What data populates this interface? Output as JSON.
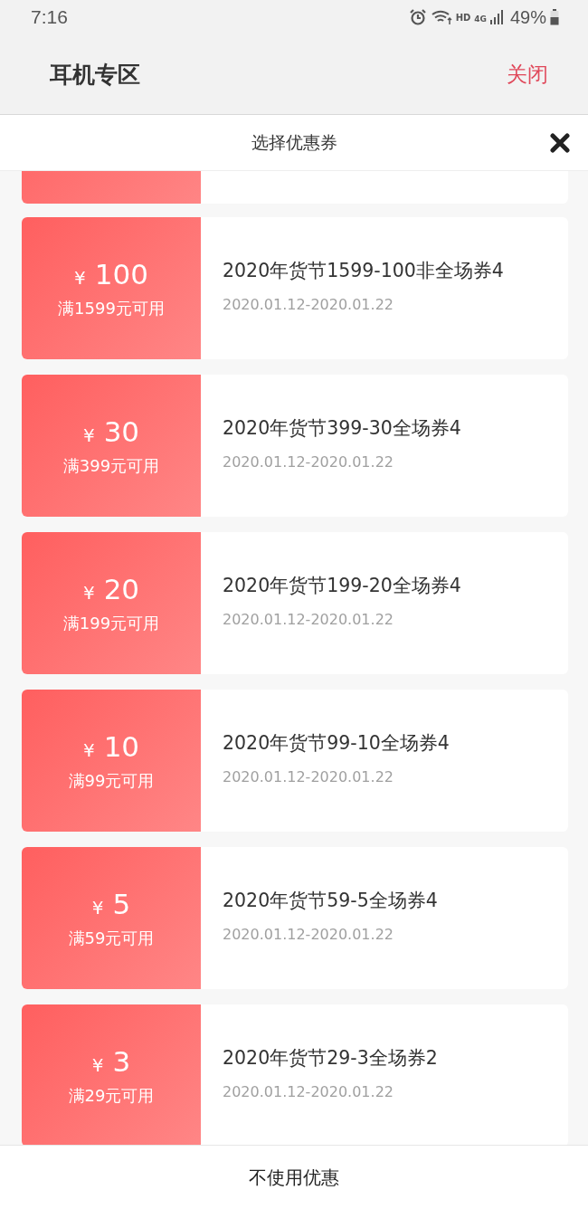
{
  "status_bar": {
    "time": "7:16",
    "hd": "HD",
    "network": "4G",
    "battery": "49%"
  },
  "header": {
    "title": "耳机专区",
    "close": "关闭"
  },
  "sheet": {
    "title": "选择优惠券",
    "coupons": [
      {
        "currency": "¥",
        "amount": "100",
        "condition": "满1599元可用",
        "name": "2020年货节1599-100非全场券4",
        "dates": "2020.01.12-2020.01.22"
      },
      {
        "currency": "¥",
        "amount": "30",
        "condition": "满399元可用",
        "name": "2020年货节399-30全场券4",
        "dates": "2020.01.12-2020.01.22"
      },
      {
        "currency": "¥",
        "amount": "20",
        "condition": "满199元可用",
        "name": "2020年货节199-20全场券4",
        "dates": "2020.01.12-2020.01.22"
      },
      {
        "currency": "¥",
        "amount": "10",
        "condition": "满99元可用",
        "name": "2020年货节99-10全场券4",
        "dates": "2020.01.12-2020.01.22"
      },
      {
        "currency": "¥",
        "amount": "5",
        "condition": "满59元可用",
        "name": "2020年货节59-5全场券4",
        "dates": "2020.01.12-2020.01.22"
      },
      {
        "currency": "¥",
        "amount": "3",
        "condition": "满29元可用",
        "name": "2020年货节29-3全场券2",
        "dates": "2020.01.12-2020.01.22"
      }
    ],
    "footer": "不使用优惠"
  }
}
